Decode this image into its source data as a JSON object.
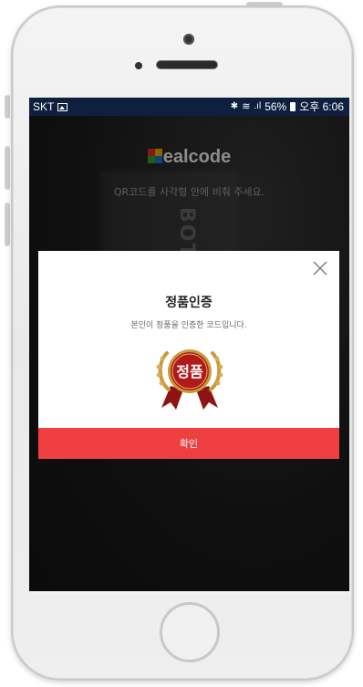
{
  "status_bar": {
    "carrier": "SKT",
    "battery_percent": "56%",
    "time": "오후 6:06"
  },
  "app": {
    "logo_prefix": "R",
    "logo_text": "ealcode",
    "guide_text": "QR코드를 사각형 안에 비춰 주세요."
  },
  "background": {
    "product_text": "BOTAN DTOX"
  },
  "dialog": {
    "title": "정품인증",
    "message": "본인이 정품을 인증한 코드입니다.",
    "badge_text": "정품",
    "confirm_label": "확인"
  },
  "colors": {
    "accent": "#ef3f41",
    "status_bar": "#0e1f3f",
    "badge_red": "#b11a1a",
    "badge_gold": "#c89a3c"
  }
}
